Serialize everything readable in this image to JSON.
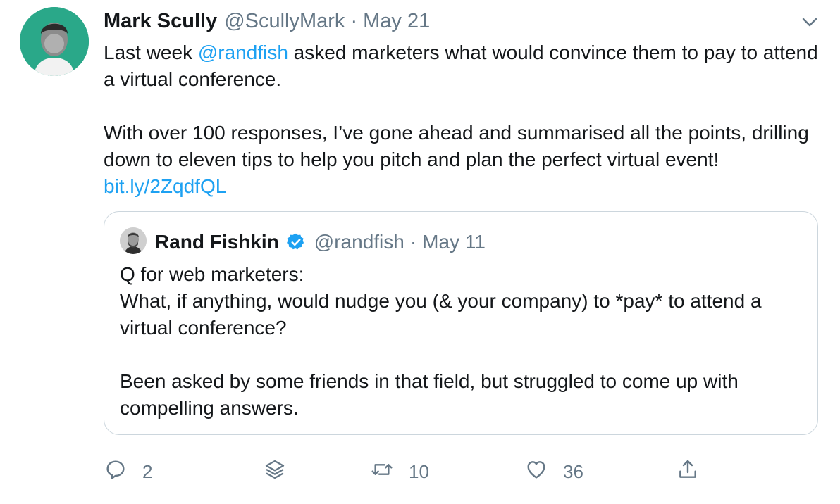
{
  "tweet": {
    "author_name": "Mark Scully",
    "handle": "@ScullyMark",
    "separator": "·",
    "date": "May 21",
    "text": {
      "p1_before": "Last week ",
      "p1_mention": "@randfish",
      "p1_after": " asked marketers what would convince them to pay to attend a virtual conference.",
      "p2_before": "With over 100 responses, I’ve gone ahead and summarised all the points, drilling down to eleven tips to help you pitch and plan the perfect virtual event! ",
      "p2_link": "bit.ly/2ZqdfQL"
    }
  },
  "quoted": {
    "author_name": "Rand Fishkin",
    "handle": "@randfish",
    "separator": "·",
    "date": "May 11",
    "line1": "Q for web marketers:",
    "line2": "What, if anything, would nudge you (& your company) to *pay* to attend a virtual conference?",
    "line3": "Been asked by some friends in that field, but struggled to come up with compelling answers."
  },
  "actions": {
    "reply_count": "2",
    "retweet_count": "10",
    "like_count": "36"
  },
  "icons": {
    "caret": "chevron-down-icon",
    "verified": "verified-badge-icon",
    "reply": "reply-icon",
    "layers": "layers-icon",
    "retweet": "retweet-icon",
    "like": "heart-icon",
    "share": "share-icon"
  },
  "colors": {
    "link": "#1da1f2",
    "muted": "#657786",
    "avatar_bg": "#2aa889",
    "border": "#ccd6dd"
  }
}
